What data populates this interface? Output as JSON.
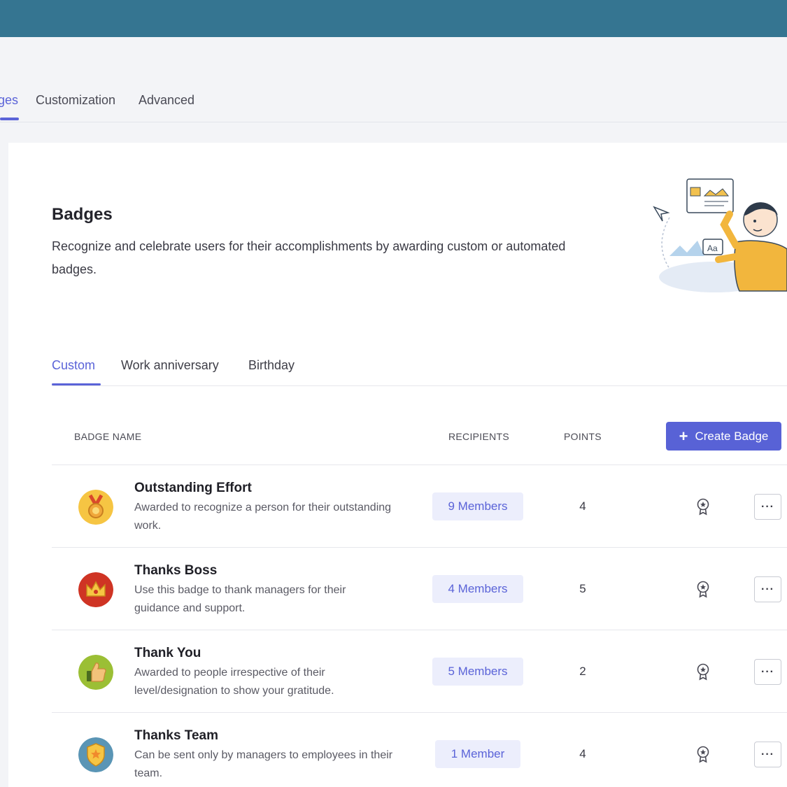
{
  "top_tabs": [
    {
      "label": "ges",
      "active": true
    },
    {
      "label": "Customization",
      "active": false
    },
    {
      "label": "Advanced",
      "active": false
    }
  ],
  "header": {
    "title": "Badges",
    "description": "Recognize and celebrate users for their accomplishments by awarding custom or automated badges."
  },
  "sub_tabs": [
    {
      "label": "Custom",
      "active": true
    },
    {
      "label": "Work anniversary",
      "active": false
    },
    {
      "label": "Birthday",
      "active": false
    }
  ],
  "table": {
    "columns": {
      "badge_name": "BADGE NAME",
      "recipients": "RECIPIENTS",
      "points": "POINTS"
    },
    "create_button": {
      "icon": "plus-icon",
      "label": "Create Badge"
    },
    "rows": [
      {
        "name": "Outstanding Effort",
        "description": "Awarded to recognize a person for their outstanding work.",
        "recipients": "9 Members",
        "points": "4",
        "icon": "medal-icon",
        "more": "···"
      },
      {
        "name": "Thanks Boss",
        "description": "Use this badge to thank managers for their guidance and support.",
        "recipients": "4 Members",
        "points": "5",
        "icon": "crown-icon",
        "more": "···"
      },
      {
        "name": "Thank You",
        "description": "Awarded to people irrespective of their level/designation to show your gratitude.",
        "recipients": "5 Members",
        "points": "2",
        "icon": "thumbs-up-icon",
        "more": "···"
      },
      {
        "name": "Thanks Team",
        "description": "Can be sent only by managers to employees in their team.",
        "recipients": "1 Member",
        "points": "4",
        "icon": "shield-star-icon",
        "more": "···"
      }
    ]
  },
  "colors": {
    "topbar": "#357591",
    "accent": "#5a63d8",
    "pill_bg": "#eceefc"
  }
}
